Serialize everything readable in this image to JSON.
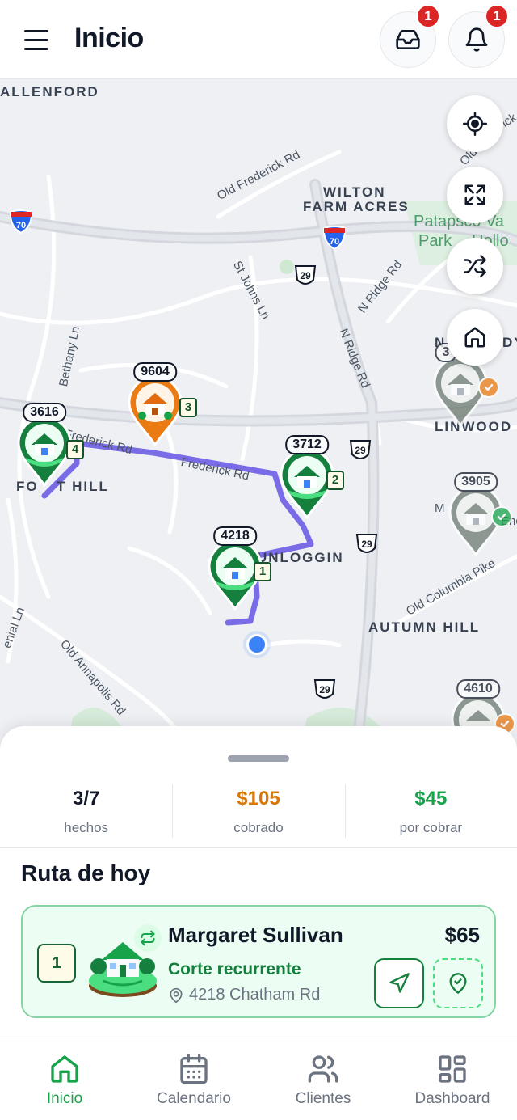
{
  "header": {
    "title": "Inicio",
    "inbox_badge": "1",
    "notifications_badge": "1"
  },
  "map": {
    "areas": [
      "ALLENFORD",
      "WILTON",
      "FARM ACRES",
      "FO",
      "T HILL",
      "LINWOOD",
      "AUTUMN HILL",
      "UNLOGGIN",
      "N",
      "DY"
    ],
    "park": [
      "Patapsco Va",
      "Park",
      "Hollo"
    ],
    "roads": [
      "Old Frederick Rd",
      "St Johns Ln",
      "N Ridge Rd",
      "N Ridge Rd",
      "Bethany Ln",
      "Frederick Rd",
      "Frederick Rd",
      "Old Columbia Pike",
      "Old Annapolis Rd",
      "enial Ln",
      "ick",
      "Old",
      "M",
      "Enco"
    ],
    "shields": [
      "70",
      "70",
      "29",
      "29",
      "29",
      "29"
    ],
    "pins": [
      {
        "number": "9604",
        "order": "3",
        "status": "pending"
      },
      {
        "number": "3616",
        "order": "4",
        "status": "pending"
      },
      {
        "number": "3712",
        "order": "2",
        "status": "pending"
      },
      {
        "number": "4218",
        "order": "1",
        "status": "pending"
      },
      {
        "number": "3",
        "status": "done"
      },
      {
        "number": "3905",
        "status": "done"
      },
      {
        "number": "4610",
        "status": "done"
      }
    ]
  },
  "stats": [
    {
      "value": "3/7",
      "label": "hechos",
      "color": "#111827"
    },
    {
      "value": "$105",
      "label": "cobrado",
      "color": "#d97706"
    },
    {
      "value": "$45",
      "label": "por cobrar",
      "color": "#16a34a"
    }
  ],
  "route": {
    "title": "Ruta de hoy",
    "stop": {
      "order": "1",
      "name": "Margaret Sullivan",
      "price": "$65",
      "service": "Corte recurrente",
      "address": "4218 Chatham Rd"
    }
  },
  "nav": [
    {
      "label": "Inicio",
      "icon": "home-icon",
      "active": true
    },
    {
      "label": "Calendario",
      "icon": "calendar-icon",
      "active": false
    },
    {
      "label": "Clientes",
      "icon": "users-icon",
      "active": false
    },
    {
      "label": "Dashboard",
      "icon": "dashboard-icon",
      "active": false
    }
  ],
  "colors": {
    "accent": "#16a34a",
    "route_line": "#6d5de6",
    "badge": "#dc2626"
  }
}
